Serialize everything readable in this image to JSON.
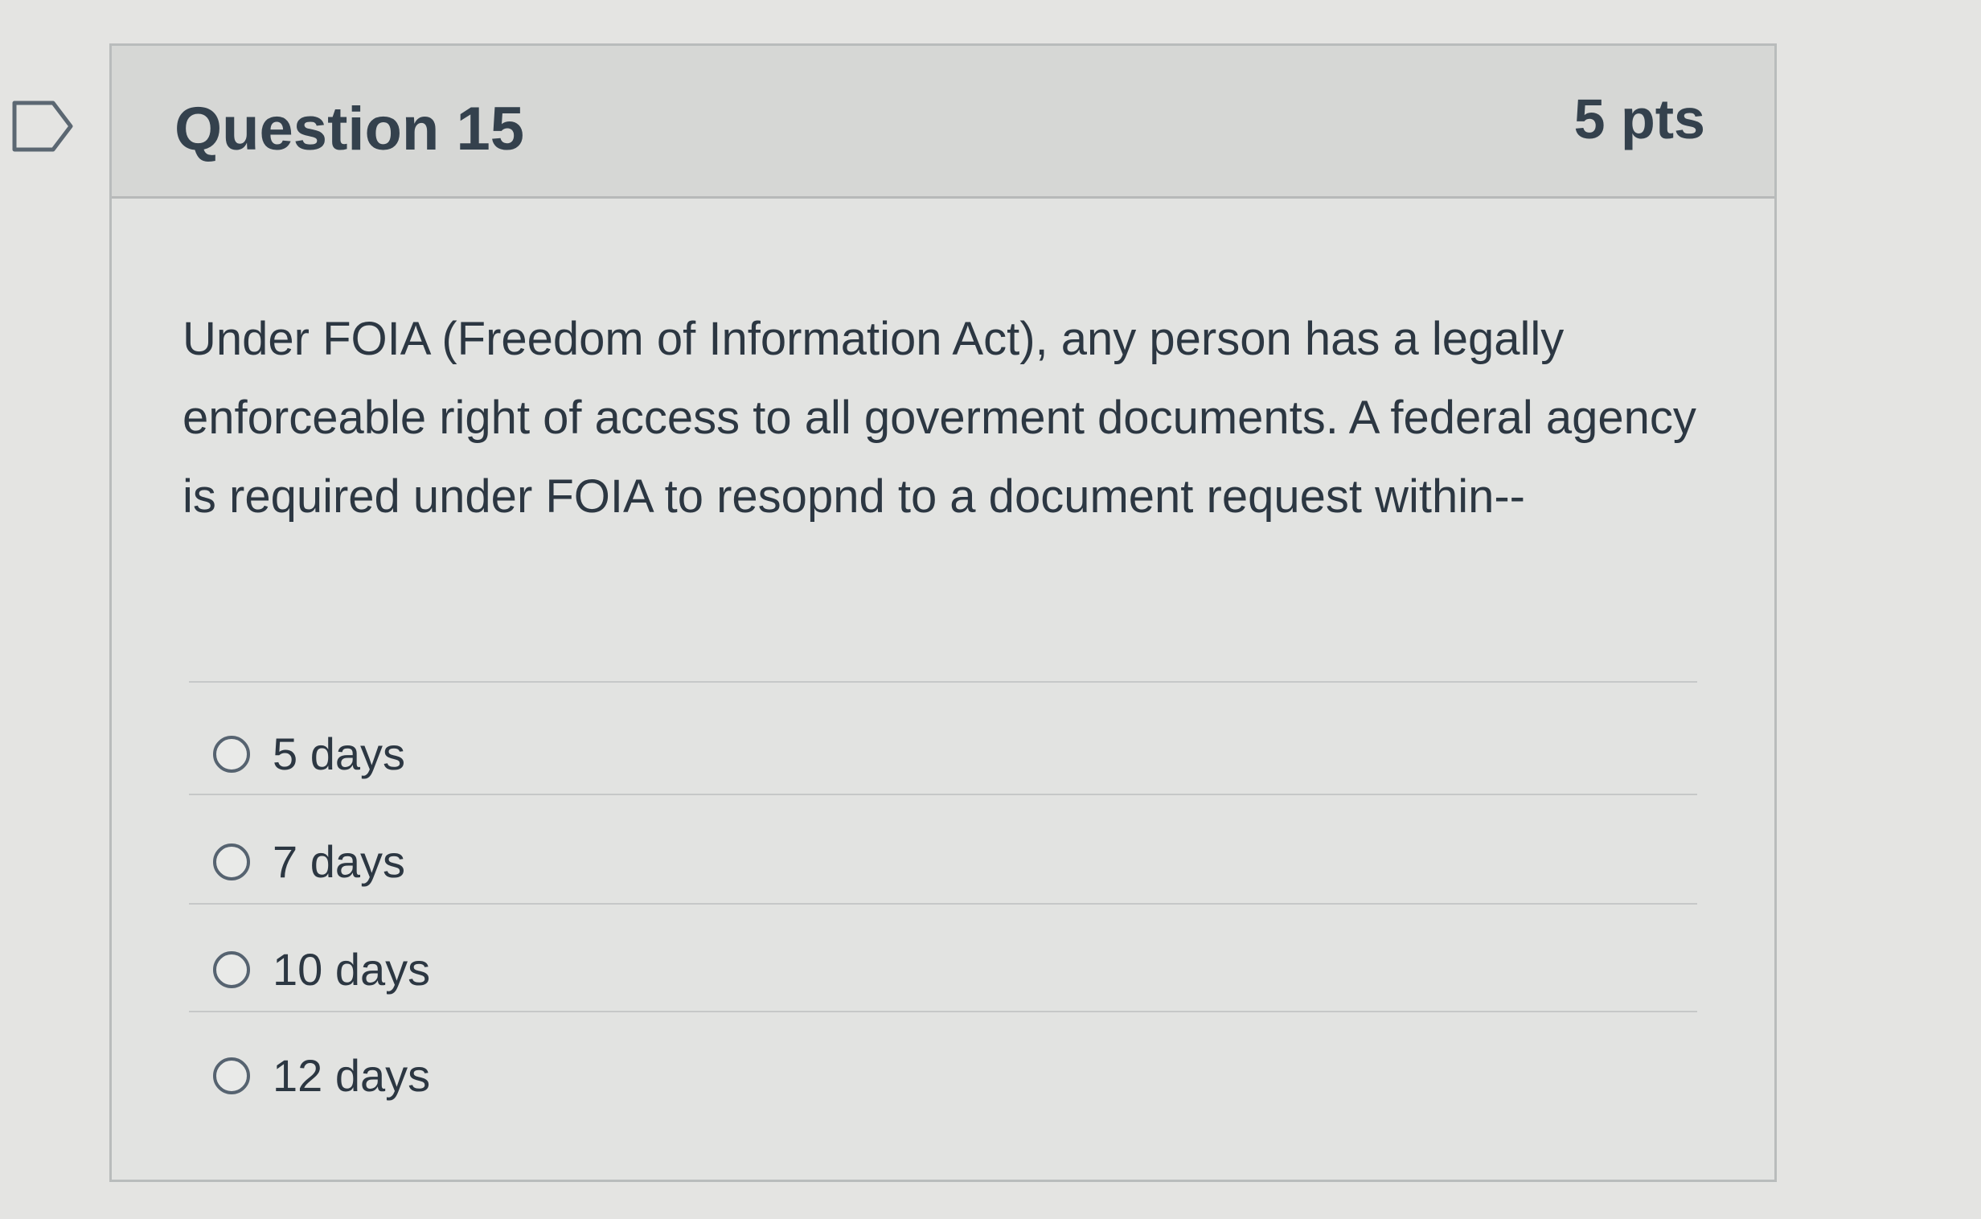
{
  "question": {
    "title": "Question 15",
    "points": "5 pts",
    "text": "Under FOIA (Freedom of Information Act), any person has a legally enforceable right of access to all goverment documents.  A federal agency is required under FOIA to resopnd to a document request within--",
    "answers": [
      {
        "label": "5 days",
        "selected": false
      },
      {
        "label": "7 days",
        "selected": false
      },
      {
        "label": "10 days",
        "selected": false
      },
      {
        "label": "12 days",
        "selected": false
      }
    ]
  },
  "icons": {
    "flag": "flag-question-icon",
    "radio": "radio-button-icon"
  }
}
